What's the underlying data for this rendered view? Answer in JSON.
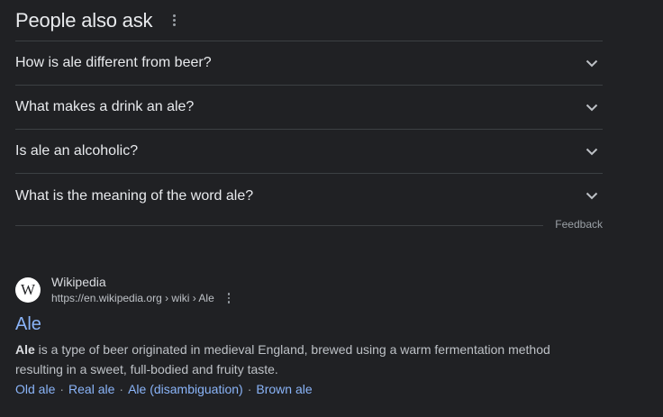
{
  "people_also_ask": {
    "title": "People also ask",
    "questions": [
      "How is ale different from beer?",
      "What makes a drink an ale?",
      "Is ale an alcoholic?",
      "What is the meaning of the word ale?"
    ],
    "feedback_label": "Feedback"
  },
  "result": {
    "favicon_letter": "W",
    "site_name": "Wikipedia",
    "url": "https://en.wikipedia.org › wiki › Ale",
    "title": "Ale",
    "snippet_bold": "Ale",
    "snippet_rest": " is a type of beer originated in medieval England, brewed using a warm fermentation method resulting in a sweet, full-bodied and fruity taste.",
    "sitelinks": [
      "Old ale",
      "Real ale",
      "Ale (disambiguation)",
      "Brown ale"
    ],
    "sitelink_separator": "·"
  },
  "colors": {
    "background": "#202124",
    "link": "#8ab4f8",
    "text_primary": "#e8eaed",
    "text_secondary": "#bdc1c6",
    "divider": "#3c4043"
  },
  "icons": {
    "paa_menu": "more-vert-icon",
    "expand": "chevron-down-icon",
    "result_menu": "more-vert-icon",
    "favicon": "wikipedia-logo-icon"
  }
}
